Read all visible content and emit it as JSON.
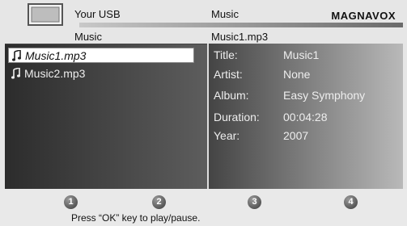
{
  "header": {
    "source_label": "Your USB",
    "category_label": "Music",
    "brand": "MAGNAVOX",
    "folder_label": "Music",
    "current_file": "Music1.mp3"
  },
  "file_list": {
    "items": [
      {
        "label": "Music1.mp3",
        "icon": "music-note-icon",
        "selected": true
      },
      {
        "label": "Music2.mp3",
        "icon": "music-note-icon",
        "selected": false
      }
    ]
  },
  "details": {
    "rows": [
      {
        "key": "Title:",
        "value": "Music1"
      },
      {
        "key": "Artist:",
        "value": "None"
      },
      {
        "key": "Album:",
        "value": "Easy Symphony"
      },
      {
        "key": "Duration:",
        "value": "00:04:28"
      },
      {
        "key": "Year:",
        "value": "2007"
      }
    ]
  },
  "footer": {
    "buttons": [
      "1",
      "2",
      "3",
      "4"
    ],
    "hint": "Press “OK” key to play/pause."
  },
  "colors": {
    "selected_bg": "#ffffff",
    "panel_dark": "#2c2c2c",
    "panel_light": "#b9b9b9"
  }
}
